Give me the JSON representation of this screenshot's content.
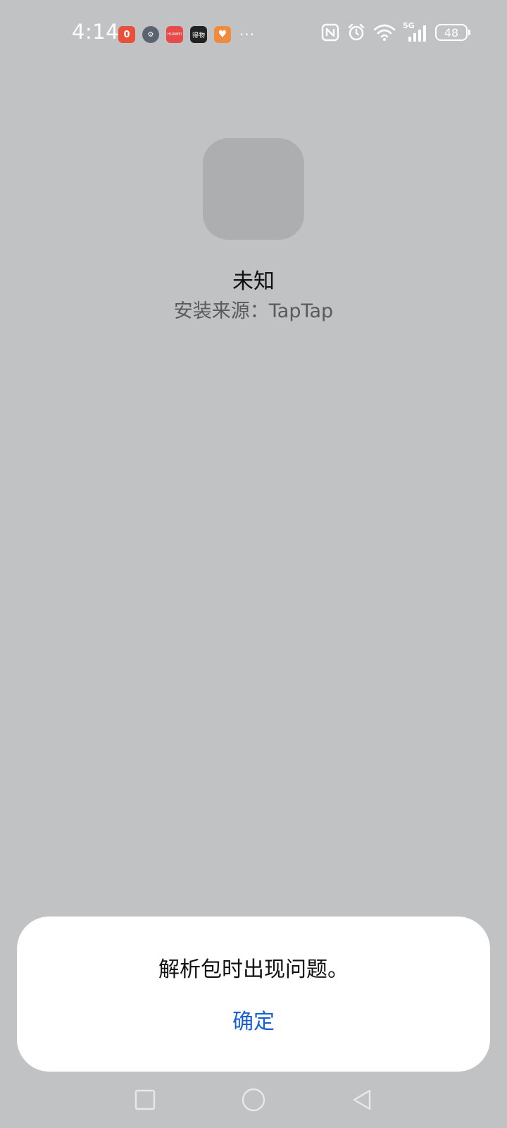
{
  "status_bar": {
    "time": "4:14",
    "notification_icons": [
      {
        "name": "notification-app-red",
        "glyph": "0",
        "color": "#e8503a"
      },
      {
        "name": "notification-app-settings",
        "glyph": "⚙",
        "color": "#5a6470"
      },
      {
        "name": "notification-app-huawei",
        "glyph": "HUAWEI",
        "color": "#e84a4a"
      },
      {
        "name": "notification-app-dewu",
        "glyph": "得物",
        "color": "#222222"
      },
      {
        "name": "notification-app-health",
        "glyph": "♥",
        "color": "#f08a3c"
      }
    ],
    "more": "···",
    "network": "5G",
    "battery": "48"
  },
  "app": {
    "name": "未知",
    "install_source": "安装来源：TapTap"
  },
  "dialog": {
    "message": "解析包时出现问题。",
    "confirm_label": "确定",
    "confirm_color": "#1a5fd1"
  },
  "nav_bar": {
    "recents_icon": "square",
    "home_icon": "circle",
    "back_icon": "triangle"
  }
}
